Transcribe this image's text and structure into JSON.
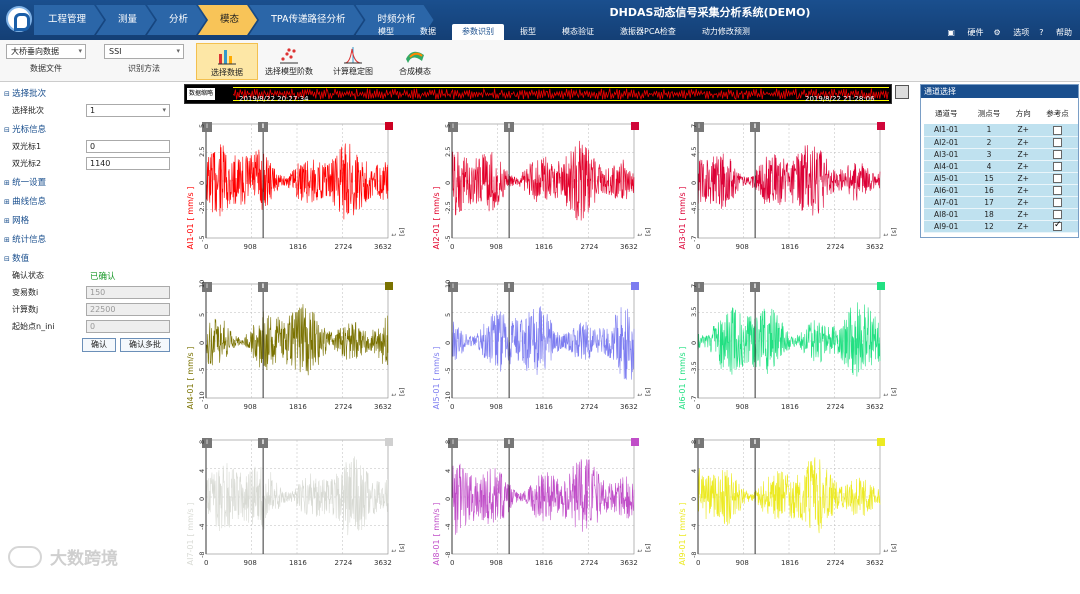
{
  "header": {
    "breadcrumb": [
      "工程管理",
      "测量",
      "分析",
      "模态",
      "TPA传递路径分析",
      "时频分析"
    ],
    "breadcrumb_active": 3,
    "title": "DHDAS动态信号采集分析系统(DEMO)",
    "menu": [
      "模型",
      "数据",
      "参数识别",
      "振型",
      "模态验证",
      "激振器PCA检查",
      "动力修改预测"
    ],
    "menu_active": 2,
    "right_menu": [
      "硬件",
      "选项",
      "帮助"
    ]
  },
  "toolbar": {
    "data_file": {
      "value": "大桥垂向数据",
      "label": "数据文件"
    },
    "method": {
      "value": "SSI",
      "label": "识别方法"
    },
    "buttons": [
      "选择数据",
      "选择模型阶数",
      "计算稳定图",
      "合成模态"
    ],
    "active_button": 0
  },
  "left_panel": {
    "sections": {
      "batch": "选择批次",
      "batch_label": "选择批次",
      "batch_value": "1",
      "cursor": "光标信息",
      "cursor1_label": "双光标1",
      "cursor1_value": "0",
      "cursor2_label": "双光标2",
      "cursor2_value": "1140",
      "unified": "统一设置",
      "curve": "曲线信息",
      "grid": "网格",
      "stats": "统计信息",
      "values": "数值",
      "confirm_state_label": "确认状态",
      "confirm_state": "已确认",
      "var_i_label": "变易数i",
      "var_i": "150",
      "calc_j_label": "计算数j",
      "calc_j": "22500",
      "start_label": "起始点n_ini",
      "start": "0",
      "btn_confirm": "确认",
      "btn_confirm_multi": "确认多批"
    }
  },
  "wavebar": {
    "label": "数据缩略",
    "start_time": "2019/8/22 20:27:34",
    "end_time": "2019/8/22 21:28:06"
  },
  "plots": [
    {
      "name": "AI1-01",
      "unit": "[ mm/s ]",
      "color": "#ff0000",
      "yticks": [
        "5",
        "2.5",
        "0",
        "-2.5",
        "-5"
      ],
      "swatch": "#cc0022"
    },
    {
      "name": "AI2-01",
      "unit": "[ mm/s ]",
      "color": "#e2002a",
      "yticks": [
        "5",
        "2.5",
        "0",
        "-2.5",
        "-5"
      ],
      "swatch": "#d0063a"
    },
    {
      "name": "AI3-01",
      "unit": "[ mm/s ]",
      "color": "#dc0036",
      "yticks": [
        "7",
        "4.5",
        "0",
        "-4.5",
        "-7"
      ],
      "swatch": "#d0063a"
    },
    {
      "name": "AI4-01",
      "unit": "[ mm/s ]",
      "color": "#7a7200",
      "yticks": [
        "10",
        "5",
        "0",
        "-5",
        "-10"
      ],
      "swatch": "#7a7200"
    },
    {
      "name": "AI5-01",
      "unit": "[ mm/s ]",
      "color": "#7c7cf0",
      "yticks": [
        "10",
        "5",
        "0",
        "-5",
        "-10"
      ],
      "swatch": "#7c7cf0"
    },
    {
      "name": "AI6-01",
      "unit": "[ mm/s ]",
      "color": "#22e082",
      "yticks": [
        "7",
        "3.5",
        "0",
        "-3.5",
        "-7"
      ],
      "swatch": "#22e082"
    },
    {
      "name": "AI7-01",
      "unit": "[ mm/s ]",
      "color": "#d8dad4",
      "yticks": [
        "8",
        "4",
        "0",
        "-4",
        "-8"
      ],
      "swatch": "#d0d0d0"
    },
    {
      "name": "AI8-01",
      "unit": "[ mm/s ]",
      "color": "#c04ec8",
      "yticks": [
        "8",
        "4",
        "0",
        "-4",
        "-8"
      ],
      "swatch": "#c04ec8"
    },
    {
      "name": "AI9-01",
      "unit": "[ mm/s ]",
      "color": "#ecea22",
      "yticks": [
        "8",
        "4",
        "0",
        "-4",
        "-8"
      ],
      "swatch": "#ecea22"
    }
  ],
  "xticks": [
    "0",
    "908",
    "1816",
    "2724",
    "3632"
  ],
  "xunit": "t [s]",
  "channel_panel": {
    "title": "通道选择",
    "headers": [
      "通道号",
      "测点号",
      "方向",
      "参考点"
    ],
    "rows": [
      {
        "ch": "AI1-01",
        "pt": "1",
        "dir": "Z+",
        "ref": false
      },
      {
        "ch": "AI2-01",
        "pt": "2",
        "dir": "Z+",
        "ref": false
      },
      {
        "ch": "AI3-01",
        "pt": "3",
        "dir": "Z+",
        "ref": false
      },
      {
        "ch": "AI4-01",
        "pt": "4",
        "dir": "Z+",
        "ref": false
      },
      {
        "ch": "AI5-01",
        "pt": "15",
        "dir": "Z+",
        "ref": false
      },
      {
        "ch": "AI6-01",
        "pt": "16",
        "dir": "Z+",
        "ref": false
      },
      {
        "ch": "AI7-01",
        "pt": "17",
        "dir": "Z+",
        "ref": false
      },
      {
        "ch": "AI8-01",
        "pt": "18",
        "dir": "Z+",
        "ref": false
      },
      {
        "ch": "AI9-01",
        "pt": "12",
        "dir": "Z+",
        "ref": true
      }
    ]
  },
  "watermark": "大数跨境"
}
